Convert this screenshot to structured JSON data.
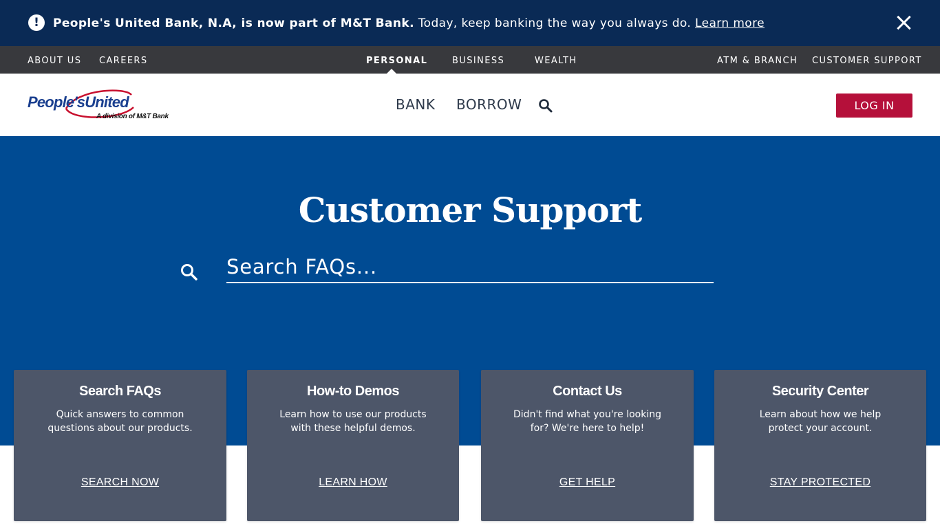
{
  "alert": {
    "bold_text": "People's United Bank, N.A, is now part of M&T Bank.",
    "text": " Today, keep banking the way you always do. ",
    "link": "Learn more",
    "icon": "exclamation-circle-icon"
  },
  "utility_nav": {
    "left": [
      "ABOUT US",
      "CAREERS"
    ],
    "center": [
      "PERSONAL",
      "BUSINESS",
      "WEALTH"
    ],
    "active": "PERSONAL",
    "right": [
      "ATM & BRANCH",
      "CUSTOMER SUPPORT"
    ]
  },
  "header": {
    "logo_name": "People'sUnited",
    "logo_sub": "A division of M&T Bank",
    "nav": [
      "BANK",
      "BORROW"
    ],
    "login": "LOG IN"
  },
  "hero": {
    "title": "Customer Support",
    "search_placeholder": "Search FAQs..."
  },
  "cards": [
    {
      "title": "Search FAQs",
      "desc": "Quick answers to common questions about our products.",
      "link": "SEARCH NOW"
    },
    {
      "title": "How-to Demos",
      "desc": "Learn how to use our products with these helpful demos.",
      "link": "LEARN HOW"
    },
    {
      "title": "Contact Us",
      "desc": "Didn't find what you're looking for? We're here to help!",
      "link": "GET HELP"
    },
    {
      "title": "Security Center",
      "desc": "Learn about how we help protect your account.",
      "link": "STAY PROTECTED"
    }
  ],
  "colors": {
    "alert_bg": "#0a2a55",
    "utility_bg": "#38393d",
    "hero_bg": "#004b93",
    "card_bg": "#4d5669",
    "login_bg": "#b5103a",
    "logo_blue": "#1a3f8f"
  }
}
